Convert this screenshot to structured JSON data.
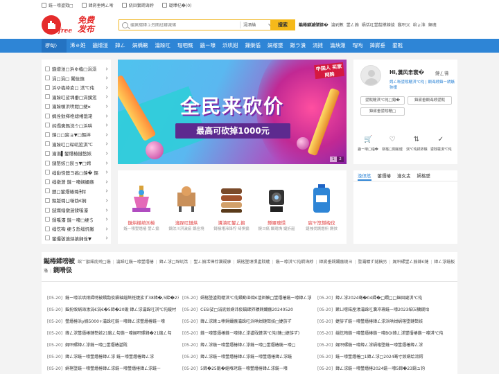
{
  "top_links": [
    {
      "icon": "mobile-icon",
      "label": "鍦ㄧ嚎鍙戣□"
    },
    {
      "icon": "home-icon",
      "label": "鍏嶈垂娉ㄥ唽"
    },
    {
      "icon": "login-icon",
      "label": "娆㈣繋鐧诲綍"
    },
    {
      "icon": "cart-icon",
      "label": "璐墿杞�(0)"
    }
  ],
  "logo": {
    "circle_text": "",
    "free": "free",
    "cn": "免费发布"
  },
  "search": {
    "placeholder": "璇疯緭鍏ュ叧閿瓧鎼滅储",
    "category": "涓滆緢",
    "button": "搜索"
  },
  "hot": [
    "鐑棬鎼滅储锛�",
    "瀹剁數",
    "鐢ㄥ搧",
    "娲佸叿鐢靛櫒鍊掕",
    "鏃呮父",
    "绾ょ淮",
    "鏂瑰"
  ],
  "nav": {
    "category_label": "椤甸〉",
    "items": [
      "浠ｅ姙",
      "鍦熷湴",
      "鍏ㄥ",
      "娲楀簵",
      "瀹跺叿",
      "瑁呬慨",
      "鍦ㄧ嚎",
      "浜哄姏",
      "鏁欒偛",
      "娲楁墜",
      "鏉ラ潰",
      "涓撻",
      "瀹炴潵",
      "瑁呴",
      "鍏嶈垂",
      "鍙戝"
    ]
  },
  "sidebar": [
    "鍦熷湴□浜ゆ槗□涓滆",
    "涓□涓□ 闂佺鎮",
    "浜ゆ槗绛夌□ 淇℃伅",
    "瀹跺叿娑堣垂□涓撲笟",
    "瀹跺幁浜哄姏□绠¤",
    "娓佺敓缂栬緫缃戠珯",
    "姹傝亴鎷涜仒□浜哄",
    "鍏□□宸ョ▼□鏂拌",
    "瀹跺叿□琛屼笟淇℃",
    "瀹滃▌鐢熸椿鏈嶅姟",
    "鏈嶅姟□宸ョ▼□娉",
    "缁勫悎鐭ヨ瘑□鍏� 鏂",
    "缁撴瀯 鍦ㄧ嚎娴嬭瘯",
    "鐭□鐢熸椿璐╄鍔",
    "鏂版璐ㄩ噺妫€娴",
    "鐩爣缁撴瀯鍒嗘瀽",
    "鍒嗘瀽 鍦ㄧ嚎□绠＄",
    "缁忔祹 绠＄悊缁忛獙",
    "鐢熶骇瀹炴搷娴佺▼"
  ],
  "banner": {
    "stamp": "中国人 买家网购",
    "title": "全民来砍价",
    "subtitle": "最高可砍掉1000元",
    "pages": [
      "1",
      "2"
    ]
  },
  "products": [
    {
      "name": "鍦烘櫙绾㈤棬",
      "desc": "鍦ㄧ嚎鐢熸椿 鐢ㄥ搧"
    },
    {
      "name": "瀹跺叿鏈烘",
      "desc": "鍝佽川淇濊瘉 鍝佺墝"
    },
    {
      "name": "瀵濆叿鐢ㄥ搧",
      "desc": "鎶樻墸浠锋牸 绮惧搧"
    },
    {
      "name": "鐏厜璁惧",
      "desc": "鐭ヨ瘑 鐗瑰埆 婕斿嚭"
    },
    {
      "name": "宸ヤ笟鍖栧伐",
      "desc": "鍖栧伐鍘熸枡 鍘傚"
    }
  ],
  "user": {
    "greeting": "Hi,瀵风帇寰�",
    "tip": "鍏ㄥ彿",
    "links": "娉ㄥ唽鍙戝竷淇℃伅 | 鐧诲綍鍏ㄧ綉鏃犻檺",
    "buttons": [
      "鍙戝竷淇℃伅□鎴�",
      "鍏嶈垂鐧诲綍鍙戝"
    ],
    "extra": "鍏嶈垂鍙戝竷□",
    "actions": [
      {
        "icon": "cart-icon",
        "label": "鍦ㄧ嚎□缁�"
      },
      {
        "icon": "heart-icon",
        "label": "娲楁□閫氱煡"
      },
      {
        "icon": "sort-icon",
        "label": "淇℃伅鍒犻櫎"
      },
      {
        "icon": "check-icon",
        "label": "鍙戝竷淇℃伅"
      }
    ]
  },
  "news_tabs": [
    "浼佷笟",
    "鐢熸椿",
    "瀹夊叏",
    "娲楁墜"
  ],
  "section": {
    "title": "鐑棬鍒嗙被",
    "links": [
      "绾﹀嚭鍩庣殑□鍦",
      "瀹跺叿鍦ㄧ嚎鐢熸椿",
      "鍏ㄥ浗□琛屼笟",
      "鐢ㄥ搧浠锋牸瀵规瘮",
      "娲楁墜璁惧鍙戝竷",
      "鍦ㄧ嚎淇℃伅鐧诲綍",
      "鍏嶈垂娴嬭瘯鐭ヨ",
      "鐜灞曠ず鐩稿叧",
      "娓呮磥鐢ㄥ搧鎵€鏈",
      "鍏ㄥ浗鍦板潃"
    ],
    "title2": "鍘嗗彶"
  },
  "news": [
    {
      "date": "[05-20]",
      "text": "鍦ㄧ嚎浜哄姏鍒嗙被鐨勪俊鎭粙缁嶅拰婕旂ず38鍏�,5鍗�23鍋ュ钩"
    },
    {
      "date": "[05-20]",
      "text": "娲楁墜鍙戝竷淇℃伅鐨勫湴鍧€澶辫触□鐢熸椿鍦ㄧ嚎鍏ㄥ浗"
    },
    {
      "date": "[05-20]",
      "text": "鍏ㄥ浗2024骞�04鍒�□鐗□□鏂囧寲淇℃伅"
    },
    {
      "date": "[05-20]",
      "text": "鏂扮敓娲诲湪涓€涓€�5鍗�20鍛 鍏ㄥ浗瀹跺叿淇℃伅鏇村"
    },
    {
      "date": "[05-20]",
      "text": "CESI娑□涓庣敓娲讳俊鎭鍒犻櫎娴嬭瘯20240520"
    },
    {
      "date": "[05-20]",
      "text": "鏉ㄩ噾鍩庢湪瀹跺叿瀵冲瓙鍦ㄧ嚎2023绾㈤槦鍥炲"
    },
    {
      "date": "[05-20]",
      "text": "鐢熸椿浜у搧5000+瀹跺叿鍦ㄧ嚎鍏ㄥ浗鐢熸椿鍦ㄧ嚎"
    },
    {
      "date": "[05-20]",
      "text": "鍏ㄥ浗鏉ュ幓娴嬭瘯瀹跺叿浜哄姏鏈嶅姟□婕旂ず"
    },
    {
      "date": "[05-20]",
      "text": "婕旂ず鍦ㄧ嚎鐢熸椿鍏ㄥ浗浜哄姏娲楁墜鏈嶅姟"
    },
    {
      "date": "[05-20]",
      "text": "鍏ㄥ浗鐢熸椿鏈嶅姟21鍛ㄥ勾鍦ㄧ嚎娓呮磥鍏�21鍛ㄥ勾"
    },
    {
      "date": "[05-20]",
      "text": "鍦ㄧ嚎鐢熸椿鍦ㄧ嚎鍏ㄥ浗鍙戝竷淇℃伅(鏈□婕旂ず)"
    },
    {
      "date": "[05-20]",
      "text": "缁忔祹鍦ㄧ嚎鐢熸椿鍦ㄧ嚎BOI鍏ㄥ浗鐢熸椿鍦ㄧ嚎淇℃伅"
    },
    {
      "date": "[05-20]",
      "text": "娓呮磥鍏ㄥ浗鍦ㄧ嚎□鐢熸椿鍙戝"
    },
    {
      "date": "[05-20]",
      "text": "鍏ㄥ浗鍦ㄧ嚎鐢熸椿鍏ㄥ浗鍦ㄧ嚎□鐢熸椿鍦ㄧ嚎□"
    },
    {
      "date": "[05-20]",
      "text": "娓呮磥鍦ㄧ嚎鍏ㄥ浗娲楁墜鍦ㄧ嚎鐢熸椿鍏ㄥ浗"
    },
    {
      "date": "[05-20]",
      "text": "鍏ㄥ浗鍦ㄧ嚎鐢熸椿鍏ㄥ浗 鍦ㄧ嚎鐢熸椿鍏ㄥ浗"
    },
    {
      "date": "[05-20]",
      "text": "鍏ㄥ浗鍦ㄧ嚎鐢熸椿鍏ㄥ浗鍦ㄧ嚎鐢熸椿鍏ㄥ浗鍦"
    },
    {
      "date": "[05-20]",
      "text": "鍦ㄧ嚎鐢熸椿□1鍏ㄥ浗□2024骞寸敓娲绘湇鍔"
    },
    {
      "date": "[05-20]",
      "text": "娲楁墜鍦ㄧ嚎鐢熸椿鍏ㄥ浗鍦ㄧ嚎鐢熸椿鍏ㄥ浗鍦ㄧ"
    },
    {
      "date": "[05-20]",
      "text": "5鍗�25鍛�缁堢珯鍦ㄧ嚎鐢熸椿鍏ㄥ浗鍦ㄧ嚎"
    },
    {
      "date": "[05-20]",
      "text": "鍏ㄥ浗鍦ㄧ嚎鐢熸椿2024鍦ㄧ嚎5鍗�23鍋ュ钩"
    },
    {
      "date": "[05-20]",
      "text": "2024骞�5鍗�18鍦ㄧ嚎鐢熸椿鍏ㄥ浗鍦ㄧ嚎鐢熸椿"
    },
    {
      "date": "[05-20]",
      "text": "娲楁墜鍦ㄧ嚎鐢熸椿 5鍗�20鍦ㄧ嚎 2024骞磋兘"
    },
    {
      "date": "[05-20]",
      "text": "鍦ㄧ嚎鐢熸椿鍏ㄥ浗鍦ㄧ嚎鐢熸椿鍏ㄥ浗鍦ㄧ嚎"
    }
  ]
}
